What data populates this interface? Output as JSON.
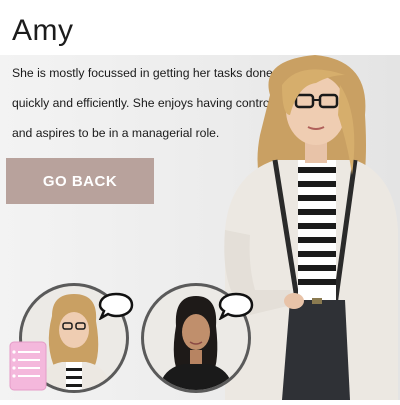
{
  "profile": {
    "name": "Amy",
    "description": "She is mostly focussed in getting her tasks done quickly and efficiently. She enjoys having control and aspires to be in a managerial role."
  },
  "actions": {
    "go_back_label": "GO BACK"
  },
  "colors": {
    "button_bg": "#b8a29c",
    "button_text": "#ffffff",
    "avatar_ring": "#5a5a5a",
    "notes_icon": "#f4b8dc"
  },
  "icons": {
    "speech": "speech-bubble-icon",
    "notes": "notepad-icon"
  }
}
